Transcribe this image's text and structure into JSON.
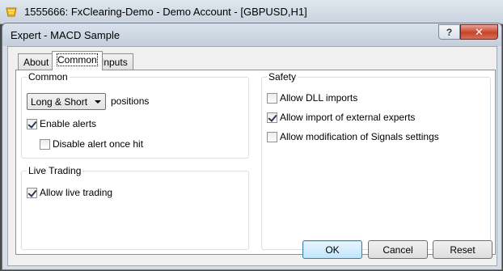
{
  "main_window": {
    "title": "1555666: FxClearing-Demo - Demo Account - [GBPUSD,H1]"
  },
  "dialog": {
    "title": "Expert - MACD Sample",
    "help_label": "?",
    "close_label": "✕"
  },
  "tabs": [
    {
      "label": "About"
    },
    {
      "label": "Common"
    },
    {
      "label": "Inputs"
    }
  ],
  "common_group": {
    "title": "Common",
    "position_select": "Long & Short",
    "positions_label": "positions",
    "enable_alerts": {
      "label": "Enable alerts",
      "checked": true
    },
    "disable_alert_once_hit": {
      "label": "Disable alert once hit",
      "checked": false
    }
  },
  "live_trading_group": {
    "title": "Live Trading",
    "allow_live_trading": {
      "label": "Allow live trading",
      "checked": true
    }
  },
  "safety_group": {
    "title": "Safety",
    "allow_dll_imports": {
      "label": "Allow DLL imports",
      "checked": false
    },
    "allow_import_external": {
      "label": "Allow import of external experts",
      "checked": true
    },
    "allow_modification_signals": {
      "label": "Allow modification of Signals settings",
      "checked": false
    }
  },
  "buttons": {
    "ok": "OK",
    "cancel": "Cancel",
    "reset": "Reset"
  }
}
